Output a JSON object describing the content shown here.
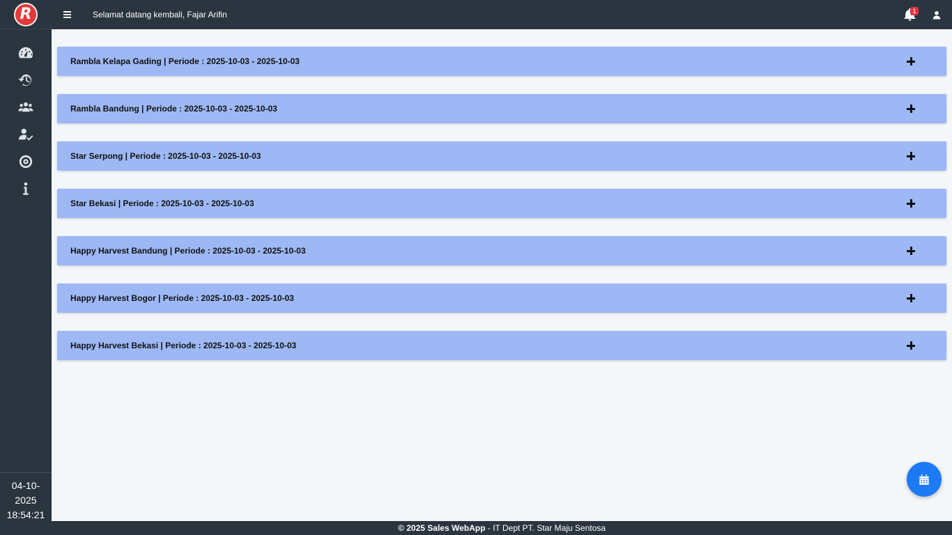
{
  "app": {
    "logo_text": "R",
    "brand_color": "#e23a3a",
    "accent_color": "#1d7af5"
  },
  "header": {
    "welcome_text": "Selamat datang kembali, Fajar Arifin",
    "notification_count": "1"
  },
  "sidebar": {
    "items": [
      {
        "icon": "dashboard-gauge-icon"
      },
      {
        "icon": "history-icon"
      },
      {
        "icon": "users-icon"
      },
      {
        "icon": "user-check-icon"
      },
      {
        "icon": "target-icon"
      },
      {
        "icon": "info-icon"
      }
    ],
    "clock": {
      "date_line1": "04-10-",
      "date_line2": "2025",
      "time": "18:54:21"
    }
  },
  "accordion": {
    "panels": [
      {
        "title": "Rambla Kelapa Gading | Periode : 2025-10-03 - 2025-10-03"
      },
      {
        "title": "Rambla Bandung | Periode : 2025-10-03 - 2025-10-03"
      },
      {
        "title": "Star Serpong | Periode : 2025-10-03 - 2025-10-03"
      },
      {
        "title": "Star Bekasi | Periode : 2025-10-03 - 2025-10-03"
      },
      {
        "title": "Happy Harvest Bandung | Periode : 2025-10-03 - 2025-10-03"
      },
      {
        "title": "Happy Harvest Bogor | Periode : 2025-10-03 - 2025-10-03"
      },
      {
        "title": "Happy Harvest Bekasi | Periode : 2025-10-03 - 2025-10-03"
      }
    ],
    "panel_color": "#9db8f4"
  },
  "fab": {
    "icon": "calendar-icon"
  },
  "footer": {
    "copyright": "© 2025 Sales WebApp",
    "separator": " - ",
    "dept": "IT Dept PT. Star Maju Sentosa"
  }
}
